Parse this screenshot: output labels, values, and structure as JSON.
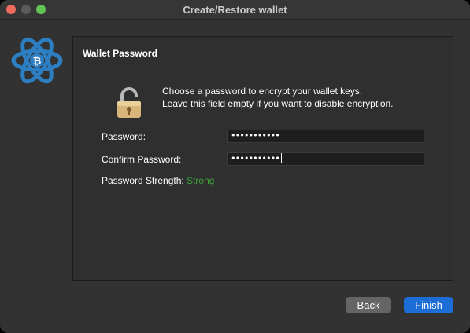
{
  "window": {
    "title": "Create/Restore wallet"
  },
  "logo": {
    "icon": "electrum-bitcoin-atom-icon",
    "color": "#2d7fc2"
  },
  "panel": {
    "title": "Wallet Password",
    "icon": "padlock-unlocked-icon",
    "message_line1": "Choose a password to encrypt your wallet keys.",
    "message_line2": "Leave this field empty if you want to disable encryption.",
    "password_label": "Password:",
    "password_value": "•••••••••••",
    "confirm_label": "Confirm Password:",
    "confirm_value": "•••••••••••",
    "strength_label": "Password Strength:",
    "strength_value": "Strong",
    "strength_color": "#3ba53a"
  },
  "buttons": {
    "back": "Back",
    "finish": "Finish",
    "finish_color": "#1c6ed6"
  }
}
